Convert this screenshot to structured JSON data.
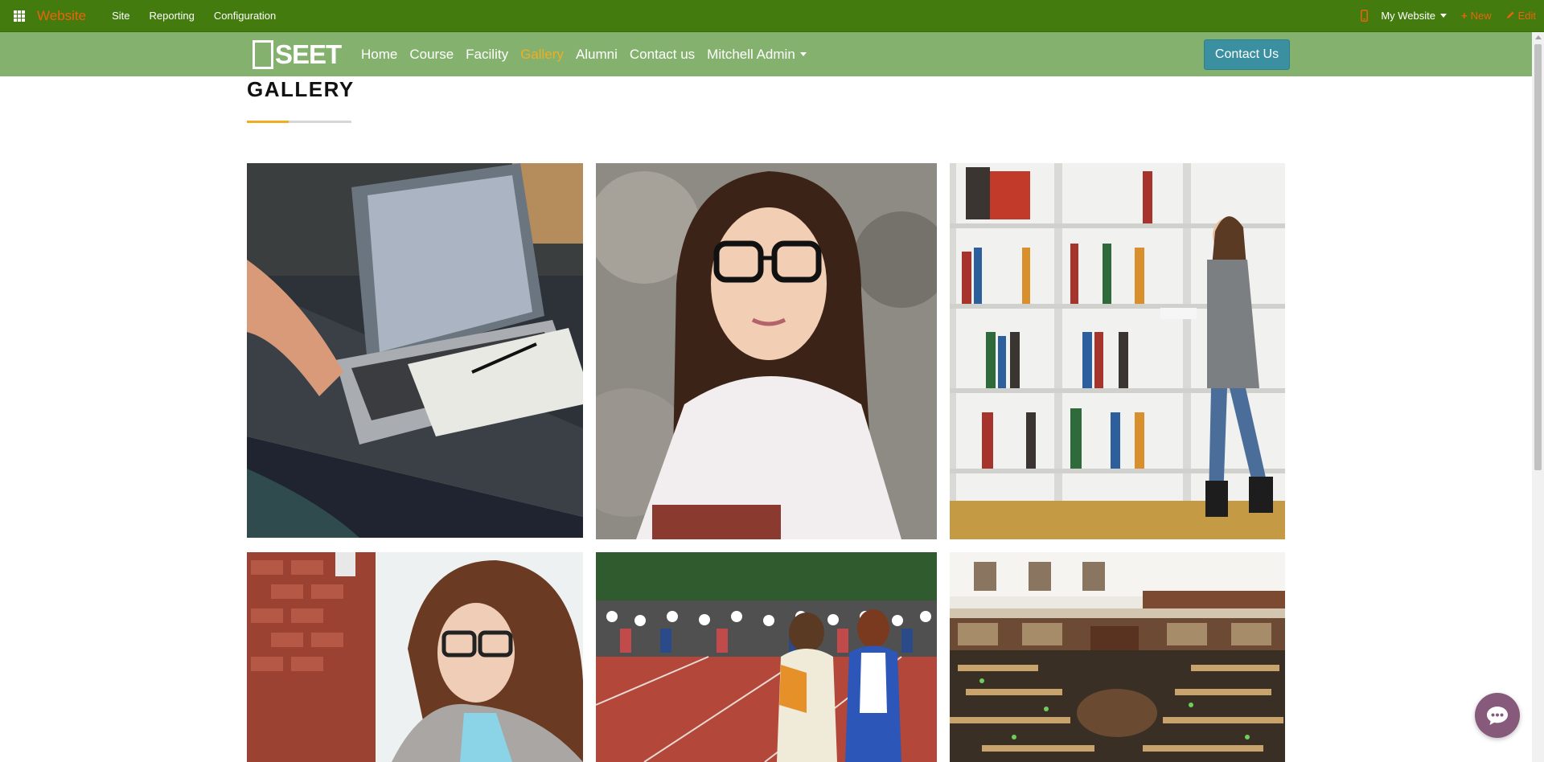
{
  "admin_bar": {
    "app_name": "Website",
    "menu": [
      "Site",
      "Reporting",
      "Configuration"
    ],
    "website_selector": "My Website",
    "new_label": "New",
    "edit_label": "Edit",
    "icons": [
      "apps-grid-icon",
      "mobile-preview-icon",
      "plus-icon",
      "pencil-icon"
    ]
  },
  "navbar": {
    "logo_text": "SEET",
    "links": [
      "Home",
      "Course",
      "Facility",
      "Gallery",
      "Alumni",
      "Contact us",
      "Mitchell Admin"
    ],
    "active_link": "Gallery",
    "cta_label": "Contact Us"
  },
  "page": {
    "title": "GALLERY"
  },
  "gallery": {
    "images": [
      "laptop-desk-photo",
      "student-portrait-photo",
      "library-bookshelf-photo",
      "woman-reading-photo",
      "students-running-track-photo",
      "reading-room-library-photo"
    ]
  },
  "colors": {
    "admin_bar": "#447b0f",
    "navbar": "#84b26e",
    "accent": "#f0ad22",
    "orange_text": "#e9640b",
    "cta": "#3a8fa0",
    "chat": "#875a7b"
  }
}
